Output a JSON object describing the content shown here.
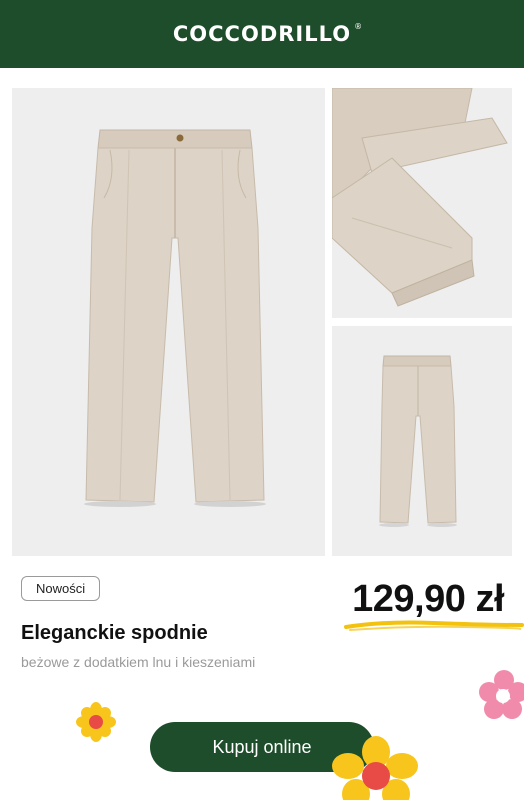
{
  "header": {
    "brand": "COCCODRILLO",
    "brand_mark": "®",
    "brand_color": "#1d4d2a"
  },
  "gallery": {
    "images": [
      {
        "name": "Trousers front view"
      },
      {
        "name": "Trousers hem detail"
      },
      {
        "name": "Trousers small view"
      }
    ]
  },
  "product": {
    "badge": "Nowości",
    "title": "Eleganckie spodnie",
    "subtitle": "beżowe z dodatkiem lnu i kieszeniami",
    "price": "129,90 zł"
  },
  "cta": {
    "label": "Kupuj online"
  },
  "colors": {
    "accent": "#1d4d2a",
    "price_underline": "#f2c20f",
    "pants": "#dcd1c3",
    "flower_pink": "#f18bab",
    "flower_yellow": "#f7c51c"
  }
}
